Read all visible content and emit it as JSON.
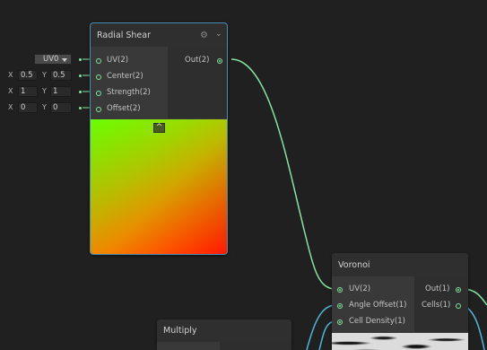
{
  "radial_shear": {
    "title": "Radial Shear",
    "inputs": [
      "UV(2)",
      "Center(2)",
      "Strength(2)",
      "Offset(2)"
    ],
    "output": "Out(2)"
  },
  "uv_dropdown": {
    "value": "UV0"
  },
  "center_field": {
    "x_label": "X",
    "x_value": "0.5",
    "y_label": "Y",
    "y_value": "0.5"
  },
  "strength_field": {
    "x_label": "X",
    "x_value": "1",
    "y_label": "Y",
    "y_value": "1"
  },
  "offset_field": {
    "x_label": "X",
    "x_value": "0",
    "y_label": "Y",
    "y_value": "0"
  },
  "voronoi": {
    "title": "Voronoi",
    "inputs": [
      "UV(2)",
      "Angle Offset(1)",
      "Cell Density(1)"
    ],
    "outputs": [
      "Out(1)",
      "Cells(1)"
    ]
  },
  "multiply": {
    "title": "Multiply"
  },
  "colors": {
    "wire": "#84e4a0",
    "selected_border": "#4a8bb0",
    "canvas": "#202020",
    "node_header": "#2f2f2f"
  },
  "icons": [
    "gear-icon",
    "chevron-down-icon",
    "collapse-preview-icon",
    "dropdown-arrow-icon"
  ]
}
